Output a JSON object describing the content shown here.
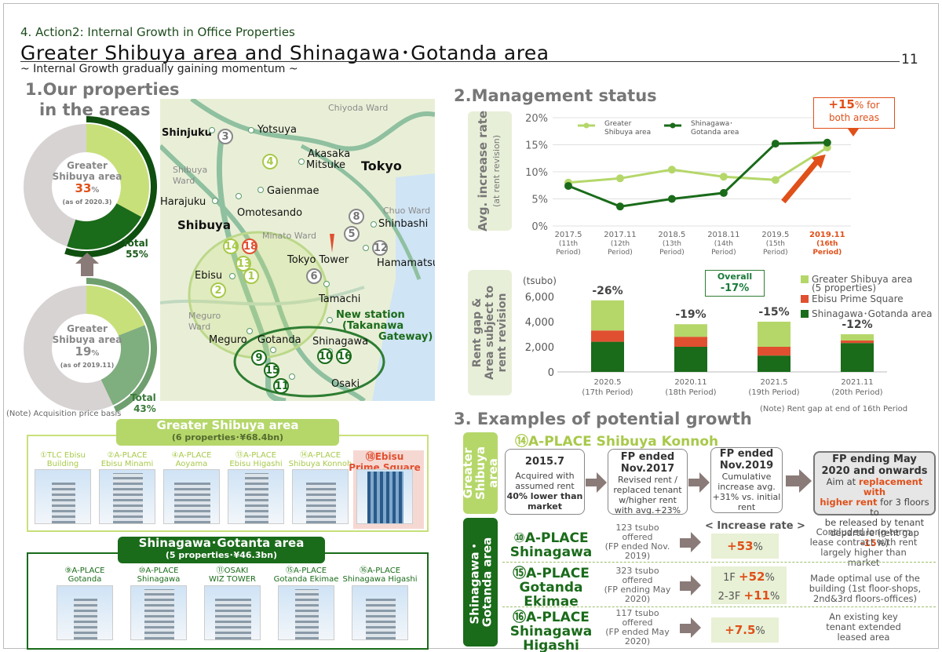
{
  "header": {
    "kicker": "4. Action2: Internal Growth in Office Properties",
    "title": "Greater Shibuya area and Shinagawa･Gotanda area",
    "subtitle": "~ Internal Growth gradually gaining momentum ~",
    "page_number": "11"
  },
  "section1": {
    "title_line1": "1.Our properties",
    "title_line2": "in the areas",
    "donut_2020": {
      "label1": "Greater",
      "label2": "Shibuya area",
      "pct": "33",
      "pct_unit": "%",
      "asof": "(as of 2020.3)",
      "total_label": "Total",
      "total_value": "55%",
      "share": 0.33,
      "total_share": 0.55
    },
    "donut_2019": {
      "label1": "Greater",
      "label2": "Shibuya area",
      "pct": "19",
      "pct_unit": "%",
      "asof": "(as of 2019.11)",
      "total_label": "Total",
      "total_value": "43%",
      "share": 0.19,
      "total_share": 0.43
    },
    "note": "(Note) Acquisition price basis",
    "map": {
      "labels": [
        "Chiyoda Ward",
        "Shinjuku",
        "Yotsuya",
        "Akasaka",
        "Mitsuke",
        "Tokyo",
        "Shibuya",
        "Ward",
        "Gaienmae",
        "Harajuku",
        "Omotesando",
        "Chuo Ward",
        "Shinbashi",
        "Minato Ward",
        "Tokyo Tower",
        "Hamamatsu",
        "Ebisu",
        "Tamachi",
        "Meguro",
        "Ward",
        "New station",
        "(Takanawa",
        "Gateway)",
        "Meguro",
        "Gotanda",
        "Shinagawa",
        "Osaki"
      ],
      "markers": [
        "3",
        "4",
        "8",
        "5",
        "12",
        "14",
        "18",
        "13",
        "1",
        "6",
        "2",
        "9",
        "15",
        "10",
        "16",
        "11"
      ]
    }
  },
  "greater_shibuya": {
    "title": "Greater Shibuya area",
    "subtitle": "(6 properties･¥68.4bn)",
    "properties": [
      {
        "l1": "①TLC Ebisu",
        "l2": "Building"
      },
      {
        "l1": "②A-PLACE",
        "l2": "Ebisu Minami"
      },
      {
        "l1": "④A-PLACE",
        "l2": "Aoyama"
      },
      {
        "l1": "⑬A-PLACE",
        "l2": "Ebisu Higashi"
      },
      {
        "l1": "⑭A-PLACE",
        "l2": "Shibuya Konnoh"
      },
      {
        "l1": "⑱Ebisu",
        "l2": "Prime Square"
      }
    ]
  },
  "shinagawa_gotanda": {
    "title": "Shinagawa･Gotanta area",
    "subtitle": "(5 properties･¥46.3bn)",
    "properties": [
      {
        "l1": "⑨A-PLACE",
        "l2": "Gotanda"
      },
      {
        "l1": "⑩A-PLACE",
        "l2": "Shinagawa"
      },
      {
        "l1": "⑪OSAKI",
        "l2": "WIZ TOWER"
      },
      {
        "l1": "⑮A-PLACE",
        "l2": "Gotanda Ekimae"
      },
      {
        "l1": "⑯A-PLACE",
        "l2": "Shinagawa Higashi"
      }
    ]
  },
  "section2": {
    "title": "2.Management status",
    "note": "(Note) Rent gap at end of 16th Period"
  },
  "chart_data": [
    {
      "type": "line",
      "ylabel": "Avg. increase rate",
      "ylabel2": "(at rent revision)",
      "ylim": [
        0,
        20
      ],
      "yticks": [
        "0%",
        "5%",
        "10%",
        "15%",
        "20%"
      ],
      "categories": [
        [
          "2017.5",
          "(11th",
          "Period)"
        ],
        [
          "2017.11",
          "(12th",
          "Period)"
        ],
        [
          "2018.5",
          "(13th",
          "Period)"
        ],
        [
          "2018.11",
          "(14th",
          "Period)"
        ],
        [
          "2019.5",
          "(15th",
          "Period)"
        ],
        [
          "2019.11",
          "(16th",
          "Period)"
        ]
      ],
      "series": [
        {
          "name": "Greater Shibuya area",
          "name_l1": "Greater",
          "name_l2": "Shibuya area",
          "color": "#b5d76a",
          "values": [
            8,
            8.8,
            10.4,
            9.1,
            8.5,
            14.5
          ]
        },
        {
          "name": "Shinagawa･Gotanda area",
          "name_l1": "Shinagawa･",
          "name_l2": "Gotanda area",
          "color": "#1a6b1a",
          "values": [
            7.4,
            3.6,
            5,
            6.1,
            15.2,
            15.4
          ]
        }
      ],
      "callout": {
        "value": "+15",
        "unit": "% for",
        "line2": "both areas"
      }
    },
    {
      "type": "bar",
      "ylabel": "Rent gap &",
      "ylabel2": "Area subject to",
      "ylabel3": "rent revision",
      "unit": "(tsubo)",
      "ylim": [
        0,
        7000
      ],
      "yticks": [
        "0",
        "2,000",
        "4,000",
        "6,000"
      ],
      "categories": [
        [
          "2020.5",
          "(17th Period)"
        ],
        [
          "2020.11",
          "(18th Period)"
        ],
        [
          "2021.5",
          "(19th Period)"
        ],
        [
          "2021.11",
          "(20th Period)"
        ]
      ],
      "gap_labels": [
        "-26%",
        "-19%",
        "-15%",
        "-12%"
      ],
      "overall_label": "Overall",
      "overall_value": "-17%",
      "series": [
        {
          "name": "Shinagawa･Gotanda area",
          "color": "#1a6b1a",
          "values": [
            2400,
            2000,
            1300,
            2300
          ]
        },
        {
          "name": "Ebisu Prime Square",
          "color": "#e05030",
          "values": [
            900,
            800,
            700,
            200
          ]
        },
        {
          "name": "Greater Shibuya area",
          "name_l2": "(5 properties)",
          "color": "#b5d76a",
          "values": [
            2400,
            1000,
            2000,
            500
          ]
        }
      ]
    }
  ],
  "section3": {
    "title": "3. Examples of potential growth",
    "gs_side": [
      "Greater",
      "Shibuya",
      "area"
    ],
    "sg_side": [
      "Shinagawa・",
      "Gotanda area"
    ],
    "konnoh_title": "⑭A-PLACE  Shibuya Konnoh",
    "steps": [
      {
        "head1": "2015.7",
        "head2": "",
        "lines": [
          "Acquired with",
          "assumed rent"
        ],
        "strong": [
          "40% lower than",
          "market"
        ]
      },
      {
        "head1": "FP ended",
        "head2": "Nov.2017",
        "lines": [
          "Revised rent /",
          "replaced tenant",
          "w/higher rent",
          "with avg.+23%"
        ]
      },
      {
        "head1": "FP ended",
        "head2": "Nov.2019",
        "lines": [
          "Cumulative",
          "increase avg.",
          "+31% vs. initial",
          "rent"
        ]
      },
      {
        "head1": "FP ending May",
        "head2": "2020 and onwards",
        "l1": "Aim at",
        "hl1": "replacement with",
        "hl2": "higher rent",
        "l2": "for 3 floors to",
        "l3": "be released by tenant",
        "l4": "departure (rent gap",
        "hl3": "-15",
        "l5": "%)"
      }
    ],
    "increase_rate_label": "< Increase rate >",
    "rows": [
      {
        "name": [
          "⑩A-PLACE",
          "Shinagawa"
        ],
        "offer": [
          "123 tsubo",
          "offered",
          "(FP ended Nov.",
          "2019)"
        ],
        "rate_val": "+53",
        "rate_unit": "%",
        "desc": [
          "Concluded long-term",
          "lease contract with rent",
          "largely higher than",
          "market"
        ]
      },
      {
        "name": [
          "⑮A-PLACE",
          "Gotanda",
          "Ekimae"
        ],
        "offer": [
          "323 tsubo",
          "offered",
          "(FP ending May",
          "2020)"
        ],
        "r1_lbl": "1F",
        "r1_val": "+52",
        "r1_unit": "%",
        "r2_lbl": "2-3F",
        "r2_val": "+11",
        "r2_unit": "%",
        "desc": [
          "Made optimal use of the",
          "building (1st floor-shops,",
          "2nd&3rd floors-offices)"
        ]
      },
      {
        "name": [
          "⑯A-PLACE",
          "Shinagawa",
          "Higashi"
        ],
        "offer": [
          "117 tsubo",
          "offered",
          "(FP ended May",
          "2020)"
        ],
        "rate_val": "+7.5",
        "rate_unit": "%",
        "desc": [
          "An existing key",
          "tenant extended",
          "leased area"
        ]
      }
    ]
  }
}
